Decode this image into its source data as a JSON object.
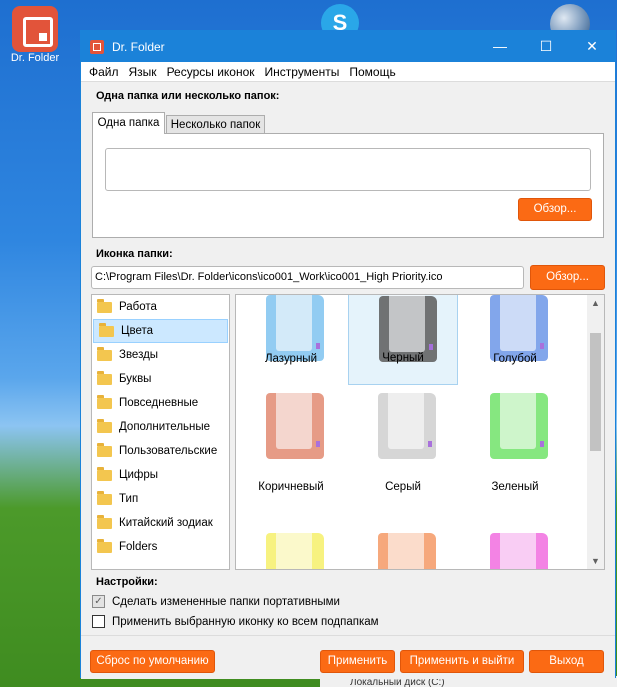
{
  "desktop": {
    "app_icon_label": "Dr. Folder",
    "taskbar_peek": "Локальный диск (C:)"
  },
  "window": {
    "title": "Dr. Folder",
    "controls": {
      "minimize": "—",
      "maximize": "☐",
      "close": "✕"
    }
  },
  "menu": [
    "Файл",
    "Язык",
    "Ресурсы иконок",
    "Инструменты",
    "Помощь"
  ],
  "folders_section": {
    "label": "Одна папка или несколько папок:",
    "tabs": [
      "Одна папка",
      "Несколько папок"
    ],
    "active_tab": "Одна папка",
    "folder_input_value": "",
    "browse_label": "Обзор..."
  },
  "icon_section": {
    "label": "Иконка папки:",
    "path_value": "C:\\Program Files\\Dr. Folder\\icons\\ico001_Work\\ico001_High Priority.ico",
    "browse_label": "Обзор..."
  },
  "categories": {
    "items": [
      "Работа",
      "Цвета",
      "Звезды",
      "Буквы",
      "Повседневные",
      "Дополнительные",
      "Пользовательские",
      "Цифры",
      "Тип",
      "Китайский зодиак",
      "Folders"
    ],
    "selected": "Цвета"
  },
  "icons": [
    {
      "label": "Лазурный",
      "color": "#7fc4f0"
    },
    {
      "label": "Черный",
      "color": "#5c5c5c",
      "selected": true
    },
    {
      "label": "Голубой",
      "color": "#6d97e8"
    },
    {
      "label": "Коричневый",
      "color": "#e28a72"
    },
    {
      "label": "Серый",
      "color": "#cfcfcf"
    },
    {
      "label": "Зеленый",
      "color": "#72e36a"
    },
    {
      "label": "",
      "color": "#f6f06a"
    },
    {
      "label": "",
      "color": "#f59a66"
    },
    {
      "label": "",
      "color": "#f16ee0"
    }
  ],
  "settings": {
    "label": "Настройки:",
    "portable_label": "Сделать измененные папки портативными",
    "portable_checked": true,
    "subfolders_label": "Применить выбранную иконку ко всем подпапкам",
    "subfolders_checked": false
  },
  "buttons": {
    "reset": "Сброс по умолчанию",
    "apply": "Применить",
    "apply_exit": "Применить и выйти",
    "exit": "Выход"
  },
  "colors": {
    "accent": "#fb6a14",
    "titlebar": "#1b82d9",
    "selection": "#cce8ff"
  }
}
